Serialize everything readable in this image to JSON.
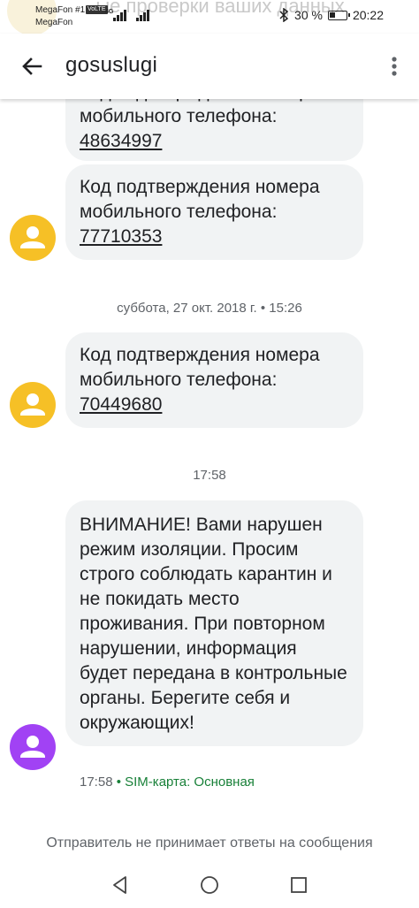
{
  "status_bar": {
    "carrier1": "MegaFon #1",
    "volte": "VoLTE",
    "net": "4G",
    "carrier2": "MegaFon",
    "battery_percent": "30 %",
    "time": "20:22"
  },
  "ghost_text": "...ые проверки ваших данных",
  "header": {
    "title": "gosuslugi"
  },
  "messages": [
    {
      "text": "Код подтверждения номера мобильного телефона: ",
      "code": "48634997"
    },
    {
      "text": "Код подтверждения номера мобильного телефона: ",
      "code": "77710353"
    },
    {
      "text": "Код подтверждения номера мобильного телефона: ",
      "code": "70449680"
    },
    {
      "text": "ВНИМАНИЕ! Вами нарушен режим изоляции. Просим строго соблюдать карантин и не покидать место проживания. При повторном нарушении, информация будет передана в контрольные органы. Берегите себя и окружающих!"
    }
  ],
  "separators": {
    "date1": "суббота, 27 окт. 2018 г. • 15:26",
    "date2": "17:58"
  },
  "last_meta": {
    "time": "17:58",
    "sim": " • SIM-карта: Основная"
  },
  "footer_note": "Отправитель не принимает ответы на сообщения",
  "colors": {
    "avatar_yellow": "#f6c026",
    "avatar_purple": "#a142f4",
    "bubble": "#f1f3f4",
    "sim_green": "#188038"
  },
  "icons": {
    "back": "arrow-left-icon",
    "menu": "more-vert-icon",
    "nav_back": "triangle-back-icon",
    "nav_home": "circle-home-icon",
    "nav_recents": "square-recents-icon"
  }
}
